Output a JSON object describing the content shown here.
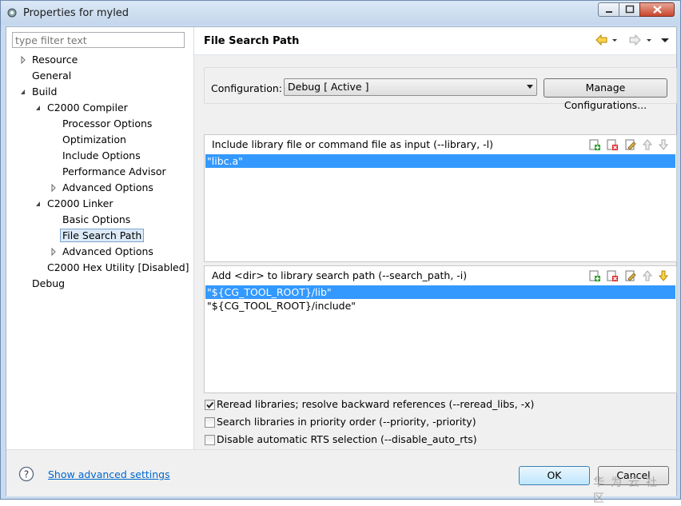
{
  "window": {
    "title": "Properties for myled"
  },
  "filter": {
    "placeholder": "type filter text"
  },
  "tree": {
    "resource": "Resource",
    "general": "General",
    "build": "Build",
    "compiler": "C2000 Compiler",
    "processor": "Processor Options",
    "optimization": "Optimization",
    "include": "Include Options",
    "perf": "Performance Advisor",
    "advanced1": "Advanced Options",
    "linker": "C2000 Linker",
    "basic": "Basic Options",
    "filesearch": "File Search Path",
    "advanced2": "Advanced Options",
    "hex": "C2000 Hex Utility  [Disabled]",
    "debug": "Debug"
  },
  "page": {
    "title": "File Search Path"
  },
  "config": {
    "label": "Configuration:",
    "value": "Debug  [ Active ]",
    "manage": "Manage Configurations..."
  },
  "library_panel": {
    "title": "Include library file or command file as input (--library, -l)",
    "items": [
      "\"libc.a\""
    ]
  },
  "search_panel": {
    "title": "Add <dir> to library search path (--search_path, -i)",
    "items": [
      "\"${CG_TOOL_ROOT}/lib\"",
      "\"${CG_TOOL_ROOT}/include\""
    ]
  },
  "options": {
    "reread": "Reread libraries; resolve backward references (--reread_libs, -x)",
    "priority": "Search libraries in priority order (--priority, -priority)",
    "rts": "Disable automatic RTS selection (--disable_auto_rts)"
  },
  "footer": {
    "advanced_link": "Show advanced settings",
    "ok": "OK",
    "cancel": "Cancel",
    "watermark": "华为云社区"
  }
}
